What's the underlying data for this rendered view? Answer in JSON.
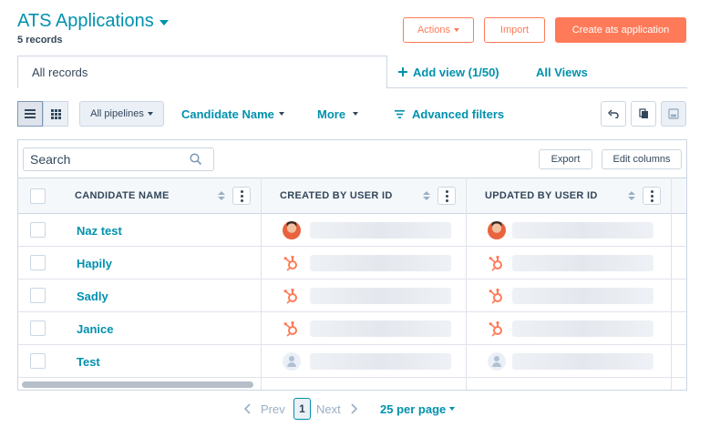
{
  "header": {
    "title": "ATS Applications",
    "record_count": "5 records"
  },
  "actions": {
    "actions_label": "Actions",
    "import_label": "Import",
    "create_label": "Create ats application"
  },
  "views": {
    "current_view": "All records",
    "add_view_label": "Add view (1/50)",
    "all_views_label": "All Views"
  },
  "toolbar": {
    "pipelines_label": "All pipelines",
    "candidate_name_filter": "Candidate Name",
    "more_label": "More",
    "advanced_filters_label": "Advanced filters"
  },
  "table": {
    "search_placeholder": "Search",
    "export_label": "Export",
    "edit_columns_label": "Edit columns",
    "columns": [
      "CANDIDATE NAME",
      "CREATED BY USER ID",
      "UPDATED BY USER ID"
    ],
    "rows": [
      {
        "name": "Naz test",
        "created_icon": "user-photo-avatar",
        "updated_icon": "user-photo-avatar"
      },
      {
        "name": "Hapily",
        "created_icon": "hubspot-icon",
        "updated_icon": "hubspot-icon"
      },
      {
        "name": "Sadly",
        "created_icon": "hubspot-icon",
        "updated_icon": "hubspot-icon"
      },
      {
        "name": "Janice",
        "created_icon": "hubspot-icon",
        "updated_icon": "hubspot-icon"
      },
      {
        "name": "Test",
        "created_icon": "default-avatar-icon",
        "updated_icon": "default-avatar-icon"
      }
    ]
  },
  "pagination": {
    "prev_label": "Prev",
    "current_page": "1",
    "next_label": "Next",
    "per_page_label": "25 per page"
  },
  "colors": {
    "accent": "#0091ae",
    "brand_orange": "#ff7a59",
    "text": "#33475b",
    "border": "#cbd6e2"
  }
}
